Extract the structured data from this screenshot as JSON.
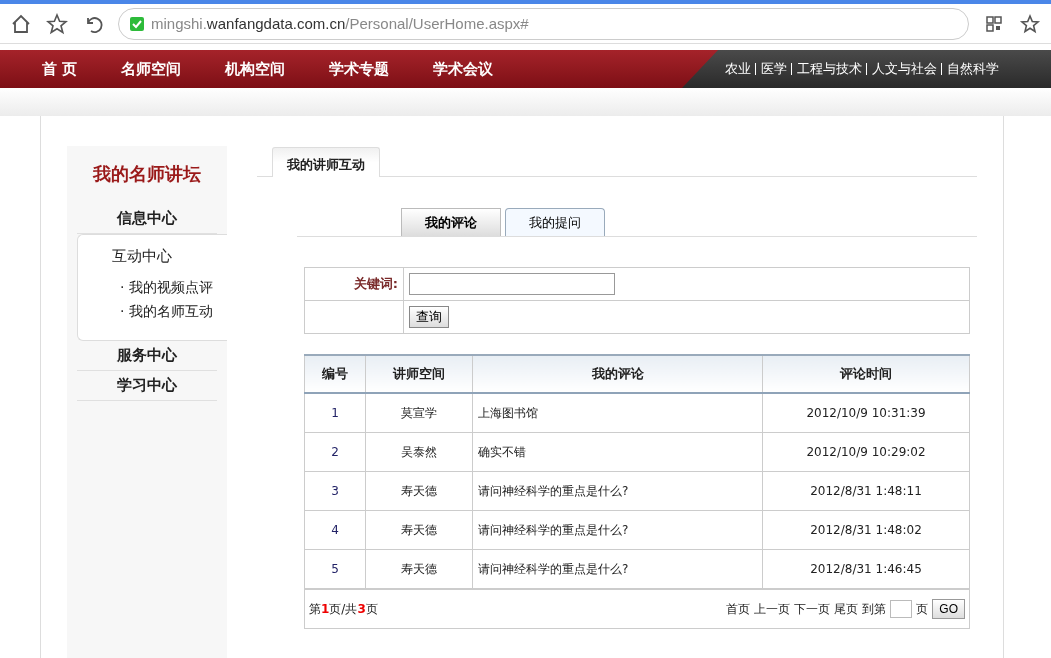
{
  "browser": {
    "url_host": "mingshi.",
    "url_domain": "wanfangdata.com.cn",
    "url_path": "/Personal/UserHome.aspx#"
  },
  "nav": {
    "items": [
      {
        "label": "首 页"
      },
      {
        "label": "名师空间"
      },
      {
        "label": "机构空间"
      },
      {
        "label": "学术专题"
      },
      {
        "label": "学术会议"
      }
    ],
    "subjects": [
      "农业",
      "医学",
      "工程与技术",
      "人文与社会",
      "自然科学"
    ]
  },
  "sidebar": {
    "title": "我的名师讲坛",
    "sections": [
      {
        "label": "信息中心",
        "expanded": false
      },
      {
        "label": "互动中心",
        "expanded": true,
        "children": [
          {
            "label": "· 我的视频点评"
          },
          {
            "label": "· 我的名师互动"
          }
        ]
      },
      {
        "label": "服务中心",
        "expanded": false
      },
      {
        "label": "学习中心",
        "expanded": false
      }
    ]
  },
  "main_tab": {
    "label": "我的讲师互动"
  },
  "tabs": [
    {
      "label": "我的评论",
      "selected": true
    },
    {
      "label": "我的提问",
      "selected": false
    }
  ],
  "search": {
    "label": "关键词:",
    "button": "查询"
  },
  "table": {
    "columns": [
      "编号",
      "讲师空间",
      "我的评论",
      "评论时间"
    ],
    "rows": [
      [
        "1",
        "莫宣学",
        "上海图书馆",
        "2012/10/9 10:31:39"
      ],
      [
        "2",
        "吴泰然",
        "确实不错",
        "2012/10/9 10:29:02"
      ],
      [
        "3",
        "寿天德",
        "请问神经科学的重点是什么?",
        "2012/8/31 1:48:11"
      ],
      [
        "4",
        "寿天德",
        "请问神经科学的重点是什么?",
        "2012/8/31 1:48:02"
      ],
      [
        "5",
        "寿天德",
        "请问神经科学的重点是什么?",
        "2012/8/31 1:46:45"
      ]
    ]
  },
  "pager": {
    "info": [
      {
        "text": "第",
        "kind": "plain"
      },
      {
        "text": "1",
        "kind": "number"
      },
      {
        "text": "页/共",
        "kind": "plain"
      },
      {
        "text": "3",
        "kind": "number"
      },
      {
        "text": "页",
        "kind": "plain"
      }
    ],
    "links": [
      "首页",
      "上一页",
      "下一页",
      "尾页"
    ],
    "goto_prefix": "到第",
    "goto_suffix": "页",
    "go": "GO"
  }
}
